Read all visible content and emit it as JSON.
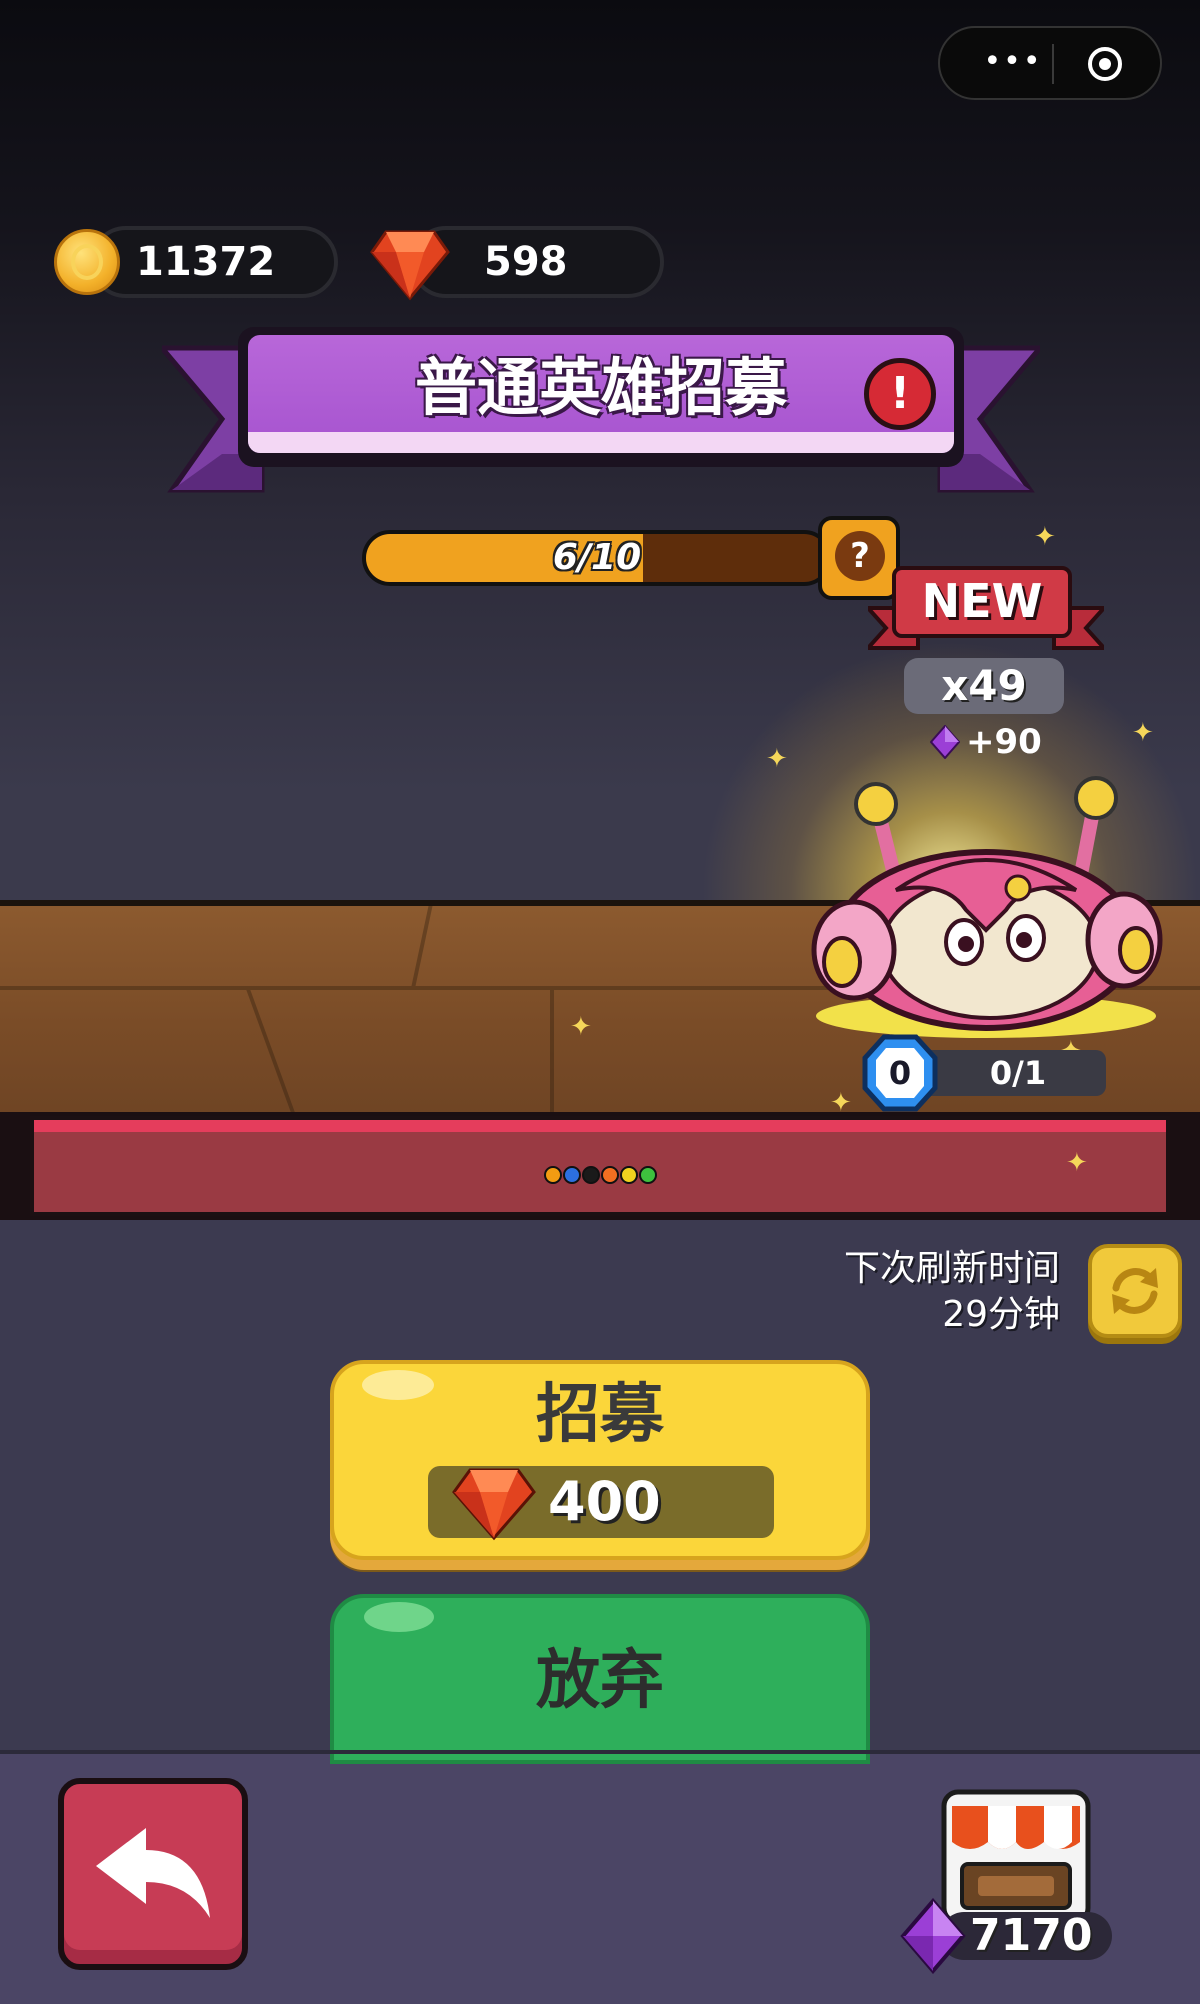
{
  "topbar": {
    "menu_icon": "more-dots-icon",
    "close_icon": "target-circle-icon"
  },
  "currency": {
    "coins": "11372",
    "gems": "598"
  },
  "banner": {
    "title": "普通英雄招募",
    "alert_icon": "!"
  },
  "progress": {
    "text": "6/10",
    "fraction": 0.6,
    "help_label": "?"
  },
  "hero": {
    "new_label": "NEW",
    "count": "x49",
    "bonus": "+90",
    "level": "0",
    "stars": "0/1"
  },
  "stage": {
    "dot_colors": [
      "#f39c12",
      "#2c6fe0",
      "#1a1a1a",
      "#f36f21",
      "#f1d21f",
      "#3ec13e"
    ]
  },
  "refresh": {
    "label_line1": "下次刷新时间",
    "label_line2": "29分钟"
  },
  "actions": {
    "recruit_label": "招募",
    "recruit_cost": "400",
    "abandon_label": "放弃"
  },
  "footer": {
    "shop_gems": "7170"
  },
  "colors": {
    "banner_purple": "#a653cf",
    "progress_orange": "#f0a21f",
    "recruit_yellow": "#fbd63a",
    "abandon_green": "#2eaf5b",
    "back_red": "#c73c55"
  }
}
